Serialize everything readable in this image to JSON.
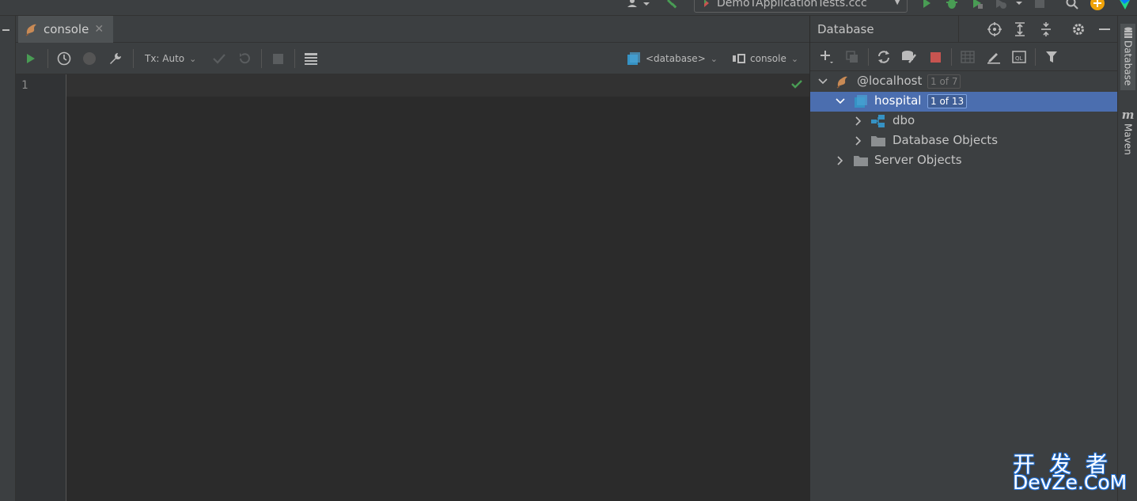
{
  "toolbar": {
    "run_config_label": "DemoTApplicationTests.ccc"
  },
  "editor_tab": {
    "label": "console",
    "close_glyph": "✕"
  },
  "editor_toolbar": {
    "tx_mode": "Tx: Auto",
    "datasource": "<database>",
    "session": "console"
  },
  "editor": {
    "line_numbers": [
      "1"
    ],
    "status": "ok"
  },
  "database_panel": {
    "title": "Database",
    "tree": [
      {
        "label": "@localhost",
        "badge": "1 of 7",
        "expanded": true,
        "level": 0,
        "icon": "mysql-dolphin-icon"
      },
      {
        "label": "hospital",
        "badge": "1 of 13",
        "expanded": true,
        "level": 1,
        "selected": true,
        "icon": "database-icon"
      },
      {
        "label": "dbo",
        "expanded": false,
        "level": 2,
        "icon": "schema-icon"
      },
      {
        "label": "Database Objects",
        "expanded": false,
        "level": 2,
        "icon": "folder-icon"
      },
      {
        "label": "Server Objects",
        "expanded": false,
        "level": 1,
        "icon": "folder-icon"
      }
    ]
  },
  "side_tabs": {
    "database": "Database",
    "maven": "Maven"
  },
  "watermark": {
    "line1": "开发者",
    "line2": "DevZe.CoM"
  },
  "colors": {
    "editor_bg": "#2b2b2b",
    "panel_bg": "#3c3f41",
    "selection": "#4b6eaf",
    "run_green": "#499c54",
    "stop_red": "#c75450",
    "db_blue": "#3592c4"
  }
}
